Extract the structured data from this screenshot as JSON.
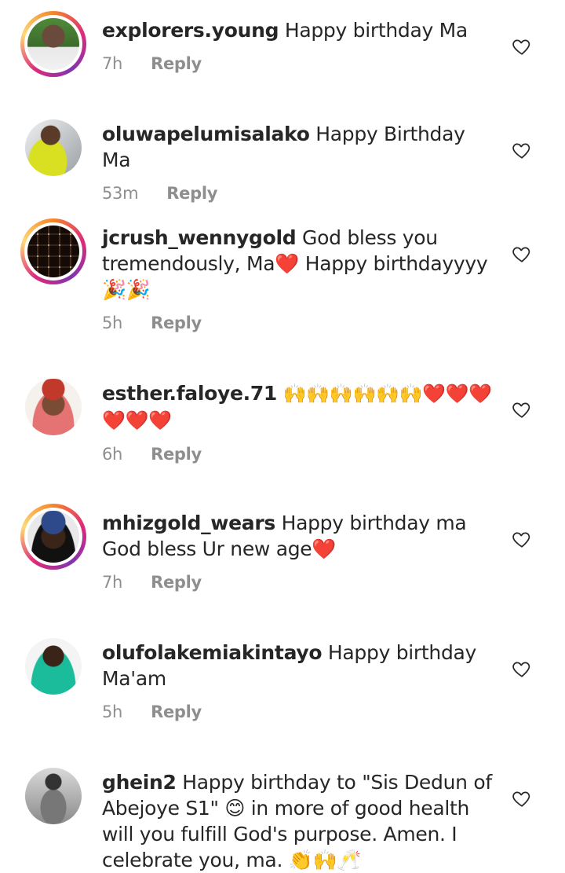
{
  "comments": [
    {
      "username": "explorers.young",
      "text": "Happy birthday Ma",
      "time": "7h",
      "reply": "Reply"
    },
    {
      "username": "oluwapelumisalako",
      "text": "Happy Birthday Ma",
      "time": "53m",
      "reply": "Reply"
    },
    {
      "username": "jcrush_wennygold",
      "text": "God bless you tremendously, Ma❤️ Happy birthdayyyy 🎉🎉",
      "time": "5h",
      "reply": "Reply"
    },
    {
      "username": "esther.faloye.71",
      "text": "🙌🙌🙌🙌🙌🙌❤️❤️❤️❤️❤️❤️",
      "time": "6h",
      "reply": "Reply"
    },
    {
      "username": "mhizgold_wears",
      "text": "Happy birthday ma God bless Ur new age❤️",
      "time": "7h",
      "reply": "Reply"
    },
    {
      "username": "olufolakemiakintayo",
      "text": "Happy birthday Ma'am",
      "time": "5h",
      "reply": "Reply"
    },
    {
      "username": "ghein2",
      "text": "Happy birthday to \"Sis Dedun of Abejoye S1\" 😊 in more of good health will you fulfill God's purpose. Amen. I celebrate you, ma. 👏🙌🥂",
      "time": "",
      "reply": ""
    }
  ],
  "icons": {
    "like": "heart-outline-icon",
    "avatar": "user-avatar"
  },
  "colors": {
    "text": "#262626",
    "meta": "#8e8e8e",
    "story_ring": "#dd2a7b"
  }
}
